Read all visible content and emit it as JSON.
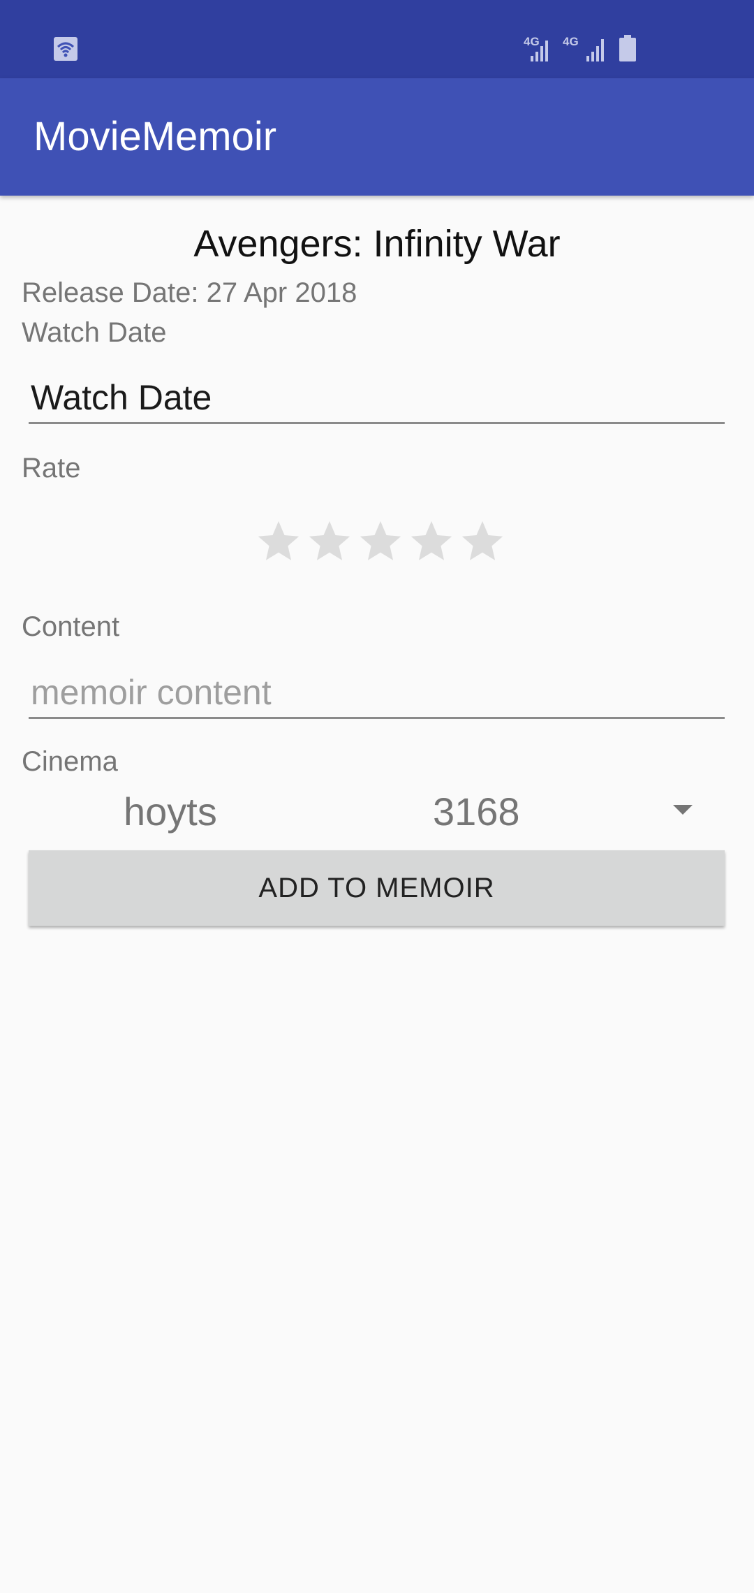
{
  "status_bar": {
    "network1": "4G",
    "network2": "4G"
  },
  "app_bar": {
    "title": "MovieMemoir"
  },
  "movie": {
    "title": "Avengers: Infinity War",
    "release_date": "Release Date: 27 Apr 2018"
  },
  "form": {
    "watch_date_label": "Watch Date",
    "watch_date_value": "Watch Date",
    "rate_label": "Rate",
    "rating": 0,
    "rating_max": 5,
    "content_label": "Content",
    "content_placeholder": "memoir content",
    "cinema_label": "Cinema",
    "cinema_name": "hoyts",
    "cinema_postcode": "3168",
    "submit_label": "ADD TO MEMOIR"
  },
  "colors": {
    "primary": "#3f51b5",
    "primary_dark": "#303f9f",
    "star_empty": "#dcdcdc"
  }
}
